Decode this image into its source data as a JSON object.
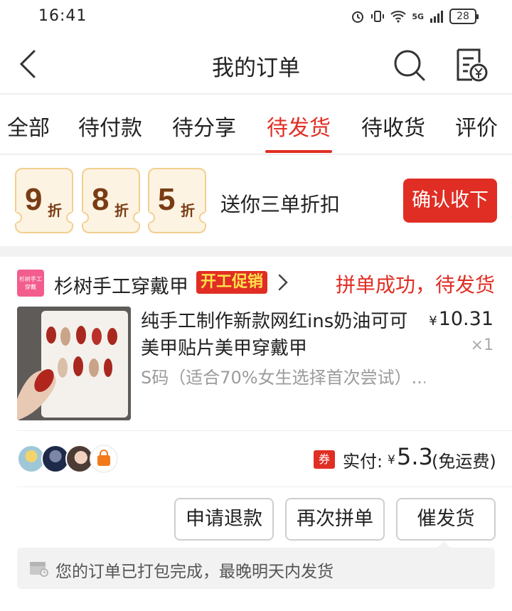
{
  "status_bar": {
    "time": "16:41",
    "battery": "28",
    "network": "5G"
  },
  "nav": {
    "title": "我的订单",
    "back_icon": "chevron-left-icon",
    "search_icon": "search-icon",
    "bill_icon": "bill-yen-icon"
  },
  "tabs": [
    {
      "label": "全部",
      "active": false
    },
    {
      "label": "待付款",
      "active": false
    },
    {
      "label": "待分享",
      "active": false
    },
    {
      "label": "待发货",
      "active": true
    },
    {
      "label": "待收货",
      "active": false
    },
    {
      "label": "评价",
      "active": false
    }
  ],
  "discount": {
    "coupons": [
      {
        "num": "9",
        "unit": "折"
      },
      {
        "num": "8",
        "unit": "折"
      },
      {
        "num": "5",
        "unit": "折"
      }
    ],
    "text": "送你三单折扣",
    "confirm_label": "确认收下"
  },
  "order": {
    "shop_logo_text": "杉树手工穿戴",
    "shop_name": "杉树手工穿戴甲",
    "promo_badge": "开工促销",
    "status": "拼单成功，待发货",
    "product": {
      "title": "纯手工制作新款网红ins奶油可可美甲贴片美甲穿戴甲",
      "price_symbol": "¥",
      "price": "10.31",
      "quantity": "×1",
      "spec": "S码（适合70%女生选择首次尝试）..."
    },
    "payment": {
      "tag": "券",
      "label": "实付:",
      "symbol": "¥",
      "amount": "5.3",
      "note": "(免运费)"
    },
    "actions": [
      {
        "label": "申请退款"
      },
      {
        "label": "再次拼单"
      },
      {
        "label": "催发货"
      }
    ],
    "tip": "您的订单已打包完成，最晚明天内发货"
  },
  "colors": {
    "accent": "#e02e24",
    "coupon_bg": "#fdf3e2",
    "coupon_text": "#7a3c14"
  }
}
